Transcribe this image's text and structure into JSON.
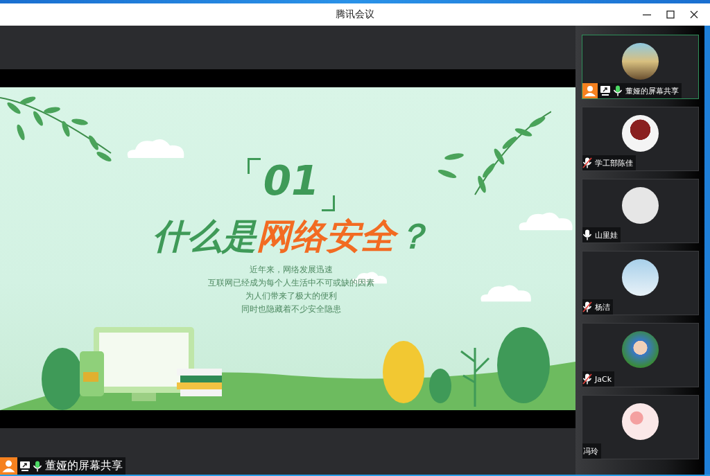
{
  "window": {
    "title": "腾讯会议"
  },
  "slide": {
    "number": "01",
    "headline": [
      {
        "text": "什么是",
        "color": "#3f9a58"
      },
      {
        "text": "网络安全",
        "color": "#f26b22"
      },
      {
        "text": "？",
        "color": "#3f9a58"
      }
    ],
    "body": [
      "近年来，网络发展迅速",
      "互联网已经成为每个人生活中不可或缺的因素",
      "为人们带来了极大的便利",
      "同时也隐藏着不少安全隐患"
    ]
  },
  "stage_label": {
    "name": "董娅的屏幕共享",
    "host": true,
    "sharing": true,
    "mic": {
      "muted": false,
      "speaking": true
    }
  },
  "participants": [
    {
      "name": "董娅的屏幕共享",
      "host": true,
      "sharing": true,
      "mic": {
        "muted": false,
        "speaking": true
      },
      "selected": true
    },
    {
      "name": "学工部陈佳",
      "host": false,
      "sharing": false,
      "mic": {
        "muted": true,
        "speaking": false
      },
      "selected": false
    },
    {
      "name": "山里娃",
      "host": false,
      "sharing": false,
      "mic": {
        "muted": false,
        "speaking": false
      },
      "selected": false
    },
    {
      "name": "杨洁",
      "host": false,
      "sharing": false,
      "mic": {
        "muted": true,
        "speaking": false
      },
      "selected": false
    },
    {
      "name": "JaCk",
      "host": false,
      "sharing": false,
      "mic": {
        "muted": true,
        "speaking": false
      },
      "selected": false
    },
    {
      "name": "冯玲",
      "host": false,
      "sharing": false,
      "selected": false
    }
  ]
}
